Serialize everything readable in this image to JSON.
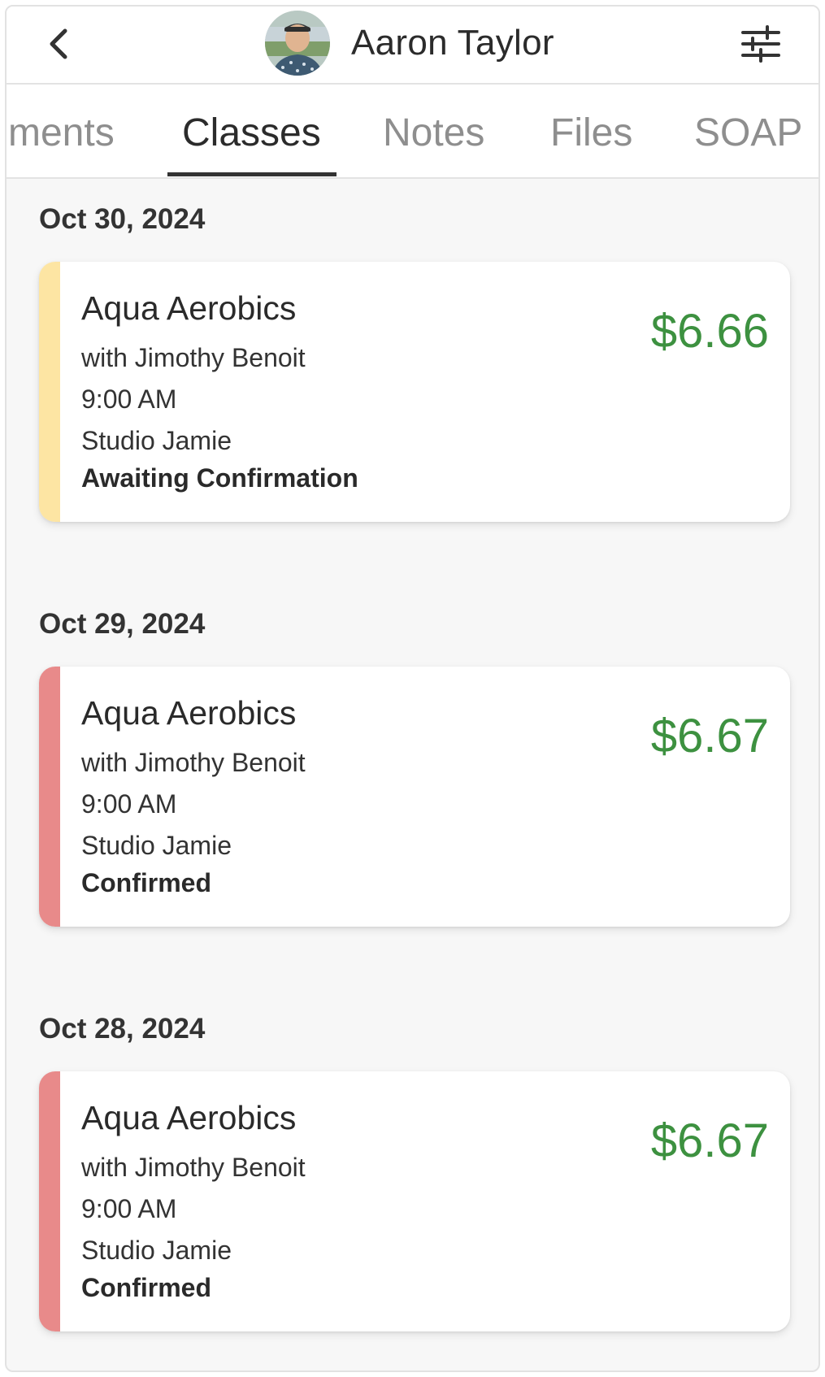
{
  "header": {
    "client_name": "Aaron Taylor",
    "back_icon": "chevron-left-icon",
    "filter_icon": "sliders-icon"
  },
  "tabs": [
    {
      "label": "ments",
      "active": false
    },
    {
      "label": "Classes",
      "active": true
    },
    {
      "label": "Notes",
      "active": false
    },
    {
      "label": "Files",
      "active": false
    },
    {
      "label": "SOAP",
      "active": false
    }
  ],
  "classes": [
    {
      "date": "Oct 30, 2024",
      "title": "Aqua Aerobics",
      "instructor": "with Jimothy Benoit",
      "time": "9:00 AM",
      "location": "Studio Jamie",
      "status": "Awaiting Confirmation",
      "price": "$6.66",
      "status_color": "#fde5a3"
    },
    {
      "date": "Oct 29, 2024",
      "title": "Aqua Aerobics",
      "instructor": "with Jimothy Benoit",
      "time": "9:00 AM",
      "location": "Studio Jamie",
      "status": "Confirmed",
      "price": "$6.67",
      "status_color": "#e88a8a"
    },
    {
      "date": "Oct 28, 2024",
      "title": "Aqua Aerobics",
      "instructor": "with Jimothy Benoit",
      "time": "9:00 AM",
      "location": "Studio Jamie",
      "status": "Confirmed",
      "price": "$6.67",
      "status_color": "#e88a8a"
    }
  ],
  "colors": {
    "price": "#3d9140",
    "tab_active": "#2b2b2b",
    "tab_inactive": "#8e8e8e"
  }
}
